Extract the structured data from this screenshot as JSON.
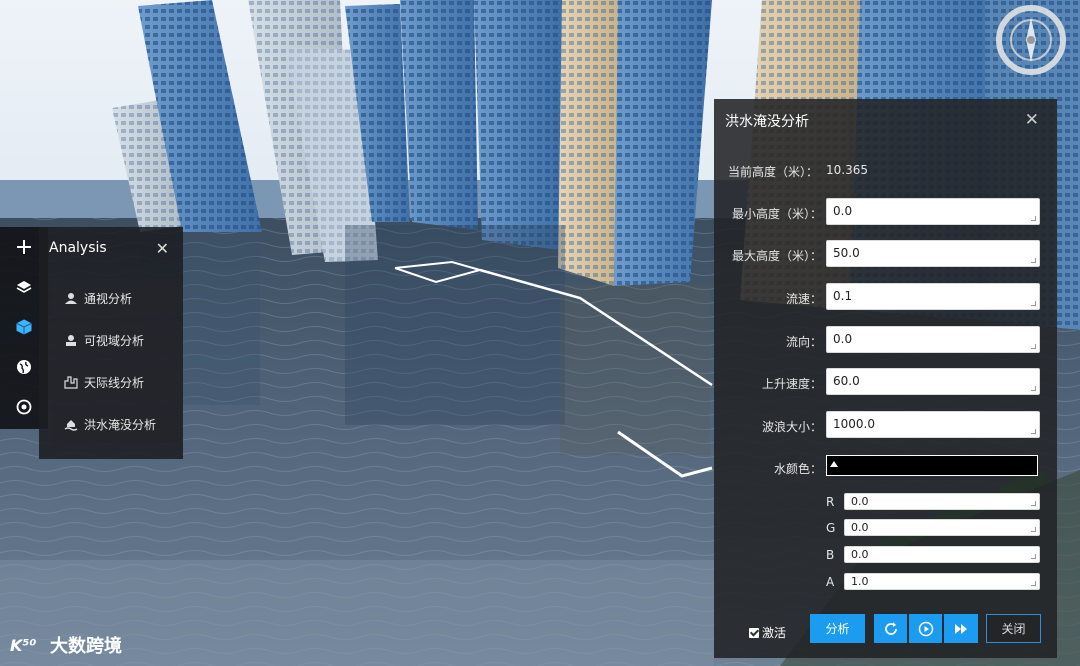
{
  "toolbar": {
    "items": [
      {
        "icon": "plus-icon"
      },
      {
        "icon": "layers-icon"
      },
      {
        "icon": "cube-icon",
        "active": true
      },
      {
        "icon": "globe-icon"
      },
      {
        "icon": "target-icon"
      }
    ],
    "accent": "#3ab5ff"
  },
  "analysis": {
    "title": "Analysis",
    "close": "✕",
    "items": [
      {
        "label": "通视分析",
        "icon": "sight-icon"
      },
      {
        "label": "可视域分析",
        "icon": "viewshed-icon"
      },
      {
        "label": "天际线分析",
        "icon": "skyline-icon"
      },
      {
        "label": "洪水淹没分析",
        "icon": "flood-icon"
      }
    ]
  },
  "flood": {
    "title": "洪水淹没分析",
    "close": "✕",
    "current_height_label": "当前高度（米）：",
    "current_height_value": "10.365",
    "min_height_label": "最小高度（米）：",
    "min_height_value": "0.0",
    "max_height_label": "最大高度（米）：",
    "max_height_value": "50.0",
    "speed_label": "流速：",
    "speed_value": "0.1",
    "direction_label": "流向：",
    "direction_value": "0.0",
    "rise_label": "上升速度：",
    "rise_value": "60.0",
    "wave_label": "波浪大小：",
    "wave_value": "1000.0",
    "color_label": "水颜色：",
    "r_label": "R",
    "r_value": "0.0",
    "g_label": "G",
    "g_value": "0.0",
    "b_label": "B",
    "b_value": "0.0",
    "a_label": "A",
    "a_value": "1.0",
    "activate_label": "激活",
    "analyze_label": "分析",
    "close_label": "关闭",
    "accent": "#1b9cf0"
  },
  "brand": {
    "text": "大数跨境"
  }
}
